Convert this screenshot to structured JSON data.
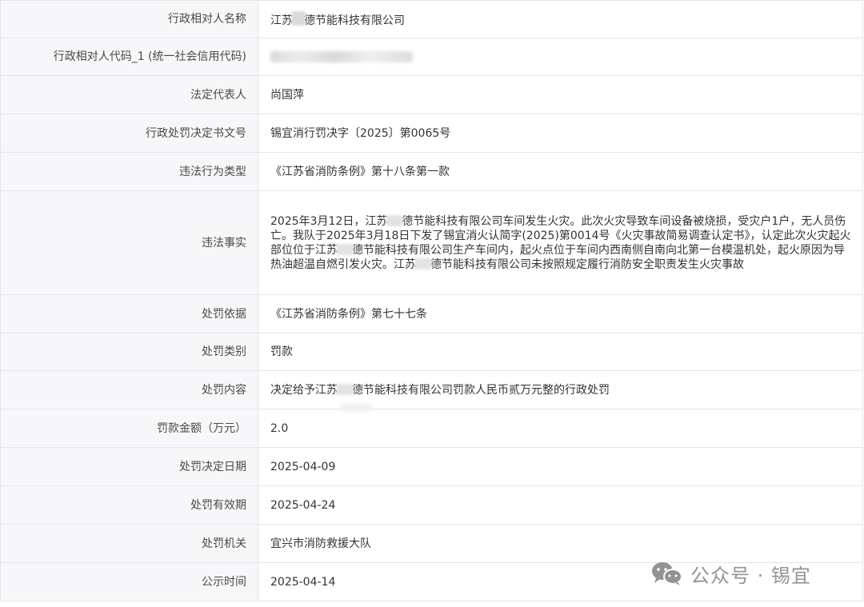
{
  "record": {
    "rows": [
      {
        "label": "行政相对人名称",
        "value_prefix": "江苏",
        "value_suffix": "德节能科技有限公司"
      },
      {
        "label": "行政相对人代码_1 (统一社会信用代码)"
      },
      {
        "label": "法定代表人",
        "value": "尚国萍"
      },
      {
        "label": "行政处罚决定书文号",
        "value": "锡宜消行罚决字〔2025〕第0065号"
      },
      {
        "label": "违法行为类型",
        "value": "《江苏省消防条例》第十八条第一款"
      },
      {
        "label": "违法事实",
        "segments": [
          "2025年3月12日，江苏",
          "德节能科技有限公司车间发生火灾。此次火灾导致车间设备被烧损，受灾户1户，无人员伤亡。我队于2025年3月18日下发了锡宜消火认简字(2025)第0014号《火灾事故简易调查认定书》，认定此次火灾起火部位位于江苏",
          "德节能科技有限公司生产车间内，起火点位于车间内西南侧自南向北第一台模温机处，起火原因为导热油超温自燃引发火灾。江苏",
          "德节能科技有限公司未按照规定履行消防安全职责发生火灾事故"
        ]
      },
      {
        "label": "处罚依据",
        "value": "《江苏省消防条例》第七十七条"
      },
      {
        "label": "处罚类别",
        "value": "罚款"
      },
      {
        "label": "处罚内容",
        "value_prefix": "决定给予江苏",
        "value_suffix": "德节能科技有限公司罚款人民币贰万元整的行政处罚"
      },
      {
        "label": "罚款金额（万元）",
        "value": "2.0"
      },
      {
        "label": "处罚决定日期",
        "value": "2025-04-09"
      },
      {
        "label": "处罚有效期",
        "value": "2025-04-24"
      },
      {
        "label": "处罚机关",
        "value": "宜兴市消防救援大队"
      },
      {
        "label": "公示时间",
        "value": "2025-04-14"
      }
    ]
  },
  "watermark": {
    "text": "公众号 · 锡宜",
    "icon": "wechat-icon"
  },
  "colors": {
    "label_bg": "#f7f7f9",
    "border": "#e4e6ea",
    "text": "#333333",
    "watermark": "#8a8a8a"
  }
}
